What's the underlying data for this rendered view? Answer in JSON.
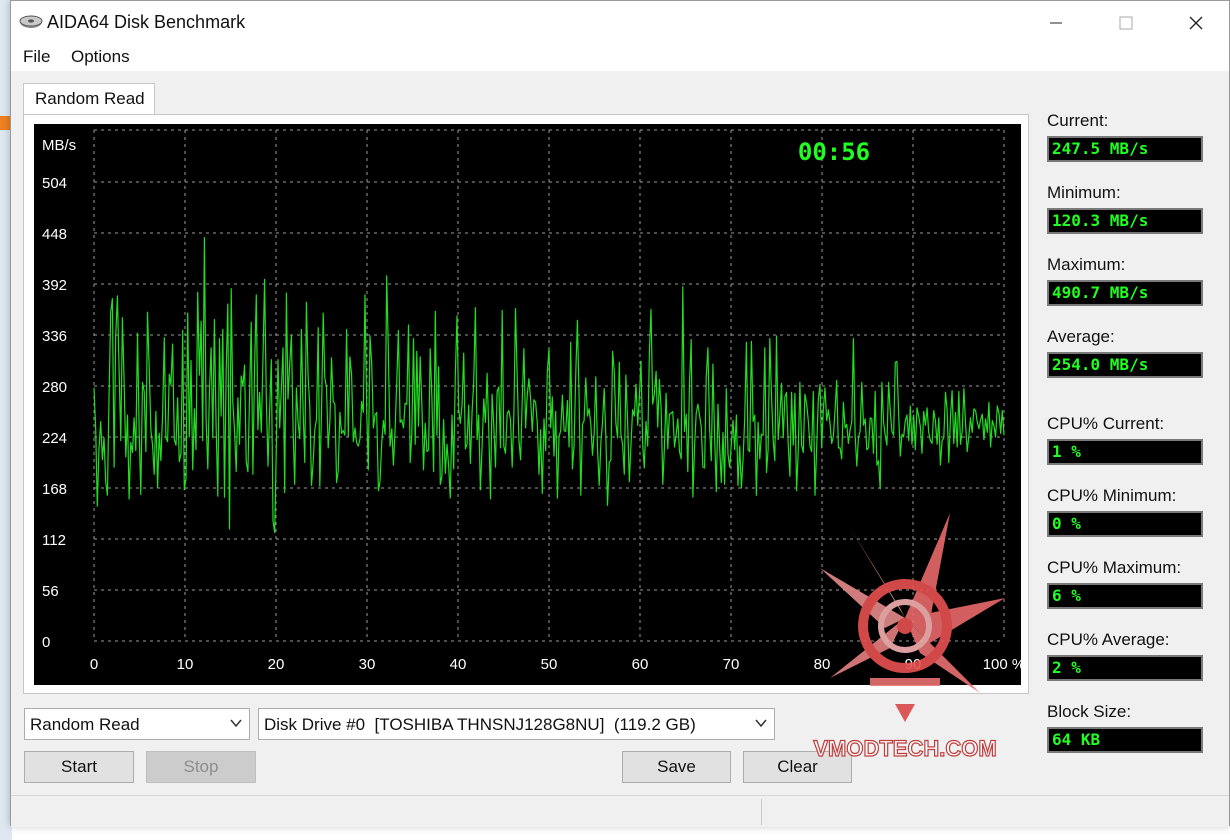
{
  "window": {
    "title": "AIDA64 Disk Benchmark"
  },
  "menu": {
    "file": "File",
    "options": "Options"
  },
  "tab": {
    "label": "Random Read"
  },
  "chart_data": {
    "type": "line",
    "title": "",
    "xlabel": "%",
    "ylabel": "MB/s",
    "timer": "00:56",
    "y_ticks": [
      "504",
      "448",
      "392",
      "336",
      "280",
      "224",
      "168",
      "112",
      "56",
      "0"
    ],
    "x_ticks": [
      "0",
      "10",
      "20",
      "30",
      "40",
      "50",
      "60",
      "70",
      "80",
      "90",
      "100 %"
    ],
    "xlim": [
      0,
      100
    ],
    "ylim": [
      0,
      504
    ],
    "grid": true,
    "line_color": "#22dd22",
    "series": [
      {
        "values": [
          278,
          232,
          148,
          212,
          241,
          199,
          223,
          175,
          160,
          272,
          361,
          376,
          191,
          334,
          379,
          298,
          220,
          355,
          285,
          202,
          248,
          156,
          218,
          207,
          245,
          209,
          338,
          229,
          161,
          284,
          274,
          208,
          361,
          300,
          231,
          216,
          183,
          252,
          168,
          228,
          198,
          249,
          333,
          223,
          219,
          293,
          281,
          326,
          221,
          215,
          267,
          197,
          206,
          341,
          166,
          178,
          360,
          224,
          308,
          188,
          255,
          210,
          383,
          292,
          351,
          220,
          443,
          243,
          189,
          273,
          322,
          223,
          353,
          237,
          159,
          332,
          247,
          342,
          158,
          298,
          370,
          123,
          387,
          262,
          232,
          186,
          267,
          216,
          291,
          280,
          303,
          197,
          186,
          271,
          350,
          183,
          302,
          380,
          232,
          273,
          229,
          312,
          397,
          267,
          192,
          251,
          309,
          132,
          119,
          211,
          309,
          234,
          278,
          322,
          163,
          382,
          266,
          304,
          336,
          232,
          172,
          278,
          240,
          222,
          342,
          253,
          196,
          372,
          291,
          257,
          171,
          195,
          232,
          244,
          344,
          170,
          252,
          360,
          289,
          279,
          212,
          241,
          311,
          263,
          260,
          174,
          187,
          251,
          228,
          231,
          226,
          342,
          225,
          312,
          292,
          219,
          234,
          218,
          214,
          222,
          263,
          251,
          380,
          253,
          188,
          335,
          304,
          234,
          248,
          251,
          165,
          175,
          217,
          242,
          227,
          401,
          316,
          214,
          233,
          193,
          232,
          287,
          341,
          240,
          243,
          234,
          261,
          260,
          347,
          196,
          227,
          332,
          216,
          318,
          236,
          312,
          259,
          188,
          239,
          208,
          210,
          321,
          267,
          186,
          362,
          226,
          301,
          172,
          181,
          243,
          184,
          216,
          193,
          157,
          248,
          189,
          291,
          357,
          255,
          239,
          258,
          316,
          211,
          216,
          259,
          195,
          252,
          284,
          366,
          221,
          248,
          166,
          214,
          266,
          240,
          294,
          230,
          156,
          271,
          236,
          191,
          274,
          279,
          212,
          363,
          214,
          206,
          250,
          253,
          243,
          191,
          250,
          365,
          290,
          221,
          199,
          263,
          321,
          234,
          271,
          288,
          266,
          230,
          265,
          262,
          239,
          183,
          232,
          162,
          244,
          209,
          295,
          321,
          234,
          268,
          203,
          252,
          157,
          224,
          231,
          270,
          231,
          230,
          264,
          213,
          328,
          189,
          215,
          295,
          352,
          267,
          160,
          238,
          242,
          289,
          247,
          255,
          238,
          204,
          229,
          290,
          212,
          171,
          218,
          240,
          277,
          223,
          149,
          196,
          199,
          318,
          297,
          239,
          223,
          306,
          227,
          216,
          183,
          292,
          241,
          175,
          216,
          254,
          247,
          282,
          237,
          267,
          307,
          216,
          190,
          241,
          214,
          318,
          364,
          260,
          271,
          296,
          235,
          287,
          256,
          172,
          212,
          272,
          211,
          249,
          250,
          252,
          213,
          226,
          244,
          208,
          200,
          389,
          230,
          249,
          186,
          283,
          331,
          158,
          212,
          250,
          260,
          247,
          236,
          191,
          190,
          289,
          322,
          233,
          198,
          304,
          225,
          164,
          260,
          214,
          174,
          229,
          172,
          277,
          205,
          191,
          216,
          242,
          210,
          248,
          171,
          214,
          168,
          198,
          244,
          328,
          210,
          208,
          329,
          241,
          248,
          160,
          240,
          200,
          227,
          226,
          322,
          185,
          210,
          332,
          270,
          220,
          198,
          335,
          221,
          246,
          283,
          223,
          268,
          273,
          216,
          181,
          273,
          215,
          272,
          165,
          208,
          284,
          215,
          207,
          271,
          261,
          242,
          214,
          208,
          274,
          160,
          210,
          265,
          282,
          212,
          254,
          278,
          242,
          254,
          239,
          217,
          225,
          253,
          286,
          212,
          212,
          200,
          262,
          234,
          238,
          217,
          232,
          241,
          332,
          227,
          192,
          224,
          230,
          284,
          237,
          244,
          210,
          212,
          245,
          244,
          206,
          274,
          193,
          198,
          167,
          284,
          240,
          226,
          215,
          284,
          252,
          230,
          226,
          306,
          307,
          251,
          203,
          227,
          224,
          242,
          248,
          220,
          258,
          216,
          248,
          210,
          256,
          247,
          235,
          206,
          252,
          237,
          256,
          229,
          220,
          217,
          253,
          242,
          216,
          245,
          193,
          220,
          223,
          273,
          254,
          196,
          247,
          275,
          217,
          251,
          213,
          274,
          216,
          230,
          277,
          240,
          208,
          226,
          245,
          229,
          255,
          253,
          241,
          233,
          243,
          249,
          221,
          244,
          229,
          262,
          213,
          242,
          236,
          224,
          258,
          250,
          228,
          253,
          226
        ]
      }
    ]
  },
  "stats": {
    "current_label": "Current:",
    "current_value": "247.5 MB/s",
    "minimum_label": "Minimum:",
    "minimum_value": "120.3 MB/s",
    "maximum_label": "Maximum:",
    "maximum_value": "490.7 MB/s",
    "average_label": "Average:",
    "average_value": "254.0 MB/s",
    "cpu_current_label": "CPU% Current:",
    "cpu_current_value": "1 %",
    "cpu_minimum_label": "CPU% Minimum:",
    "cpu_minimum_value": "0 %",
    "cpu_maximum_label": "CPU% Maximum:",
    "cpu_maximum_value": "6 %",
    "cpu_average_label": "CPU% Average:",
    "cpu_average_value": "2 %",
    "block_size_label": "Block Size:",
    "block_size_value": "64 KB"
  },
  "controls": {
    "test_select": "Random Read",
    "drive_select": "Disk Drive #0  [TOSHIBA THNSNJ128G8NU]  (119.2 GB)",
    "start": "Start",
    "stop": "Stop",
    "save": "Save",
    "clear": "Clear"
  },
  "watermark": {
    "text": "VMODTECH.COM"
  },
  "colors": {
    "accent_green": "#20ff20",
    "chart_bg": "#000000",
    "watermark_red": "#e85050"
  }
}
